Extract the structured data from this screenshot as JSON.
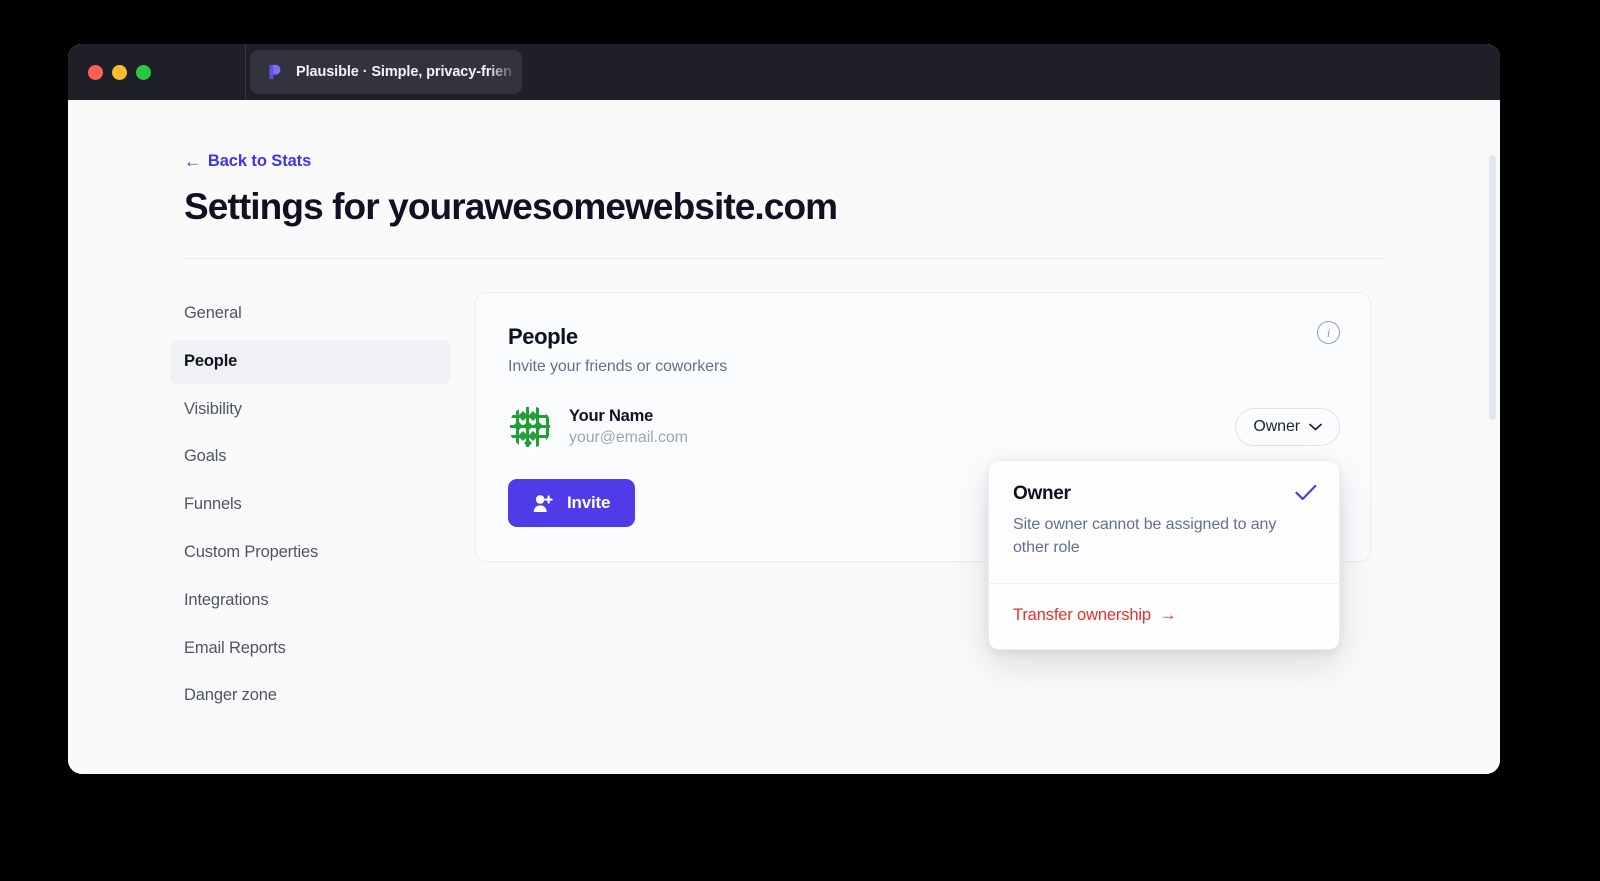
{
  "window": {
    "traffic_lights": [
      "close",
      "minimize",
      "maximize"
    ],
    "tab": {
      "title": "Plausible · Simple, privacy-frien",
      "favicon": "plausible-logo-icon"
    }
  },
  "header": {
    "back_link": "Back to Stats",
    "back_arrow": "←",
    "page_title": "Settings for yourawesomewebsite.com"
  },
  "sidebar": {
    "items": [
      {
        "label": "General",
        "active": false
      },
      {
        "label": "People",
        "active": true
      },
      {
        "label": "Visibility",
        "active": false
      },
      {
        "label": "Goals",
        "active": false
      },
      {
        "label": "Funnels",
        "active": false
      },
      {
        "label": "Custom Properties",
        "active": false
      },
      {
        "label": "Integrations",
        "active": false
      },
      {
        "label": "Email Reports",
        "active": false
      },
      {
        "label": "Danger zone",
        "active": false
      }
    ]
  },
  "card": {
    "title": "People",
    "subtitle": "Invite your friends or coworkers",
    "info_icon_label": "i",
    "member": {
      "name": "Your Name",
      "email": "your@email.com",
      "avatar": "identicon-avatar",
      "role": "Owner"
    },
    "invite_button": "Invite"
  },
  "dropdown": {
    "option_title": "Owner",
    "option_description": "Site owner cannot be assigned to any other role",
    "selected": true,
    "transfer_label": "Transfer ownership",
    "transfer_arrow": "→"
  },
  "colors": {
    "accent": "#4f3ce8",
    "link": "#3f34ee",
    "danger": "#e8302c",
    "avatar_green": "#21a03a",
    "titlebar": "#1e1f27",
    "tab_bg": "#32333d",
    "page_bg": "#fafafb"
  }
}
